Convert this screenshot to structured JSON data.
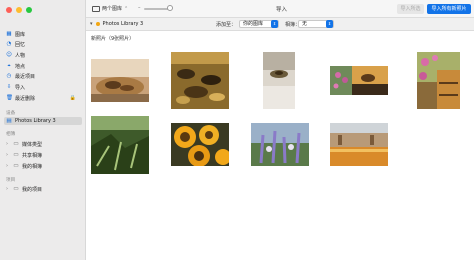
{
  "sidebar": {
    "sections": [
      {
        "title": ""
      },
      {
        "title": "设备"
      },
      {
        "title": "相簿"
      },
      {
        "title": "项目"
      }
    ],
    "library_items": [
      {
        "label": "图库",
        "icon": "photos-icon"
      },
      {
        "label": "回忆",
        "icon": "memories-icon"
      },
      {
        "label": "人物",
        "icon": "people-icon"
      },
      {
        "label": "地点",
        "icon": "places-icon"
      },
      {
        "label": "最近项目",
        "icon": "recents-icon"
      },
      {
        "label": "导入",
        "icon": "import-icon"
      },
      {
        "label": "最近删除",
        "icon": "trash-icon",
        "locked": true
      }
    ],
    "device_items": [
      {
        "label": "Photos Library 3",
        "icon": "library-icon",
        "selected": true
      }
    ],
    "album_items": [
      {
        "label": "媒体类型"
      },
      {
        "label": "共享相簿"
      },
      {
        "label": "我的相簿"
      }
    ],
    "project_items": [
      {
        "label": "我的项目"
      }
    ]
  },
  "toolbar": {
    "view_label": "两个图库",
    "title": "导入",
    "import_selected_label": "导入所选",
    "import_all_label": "导入所有新照片"
  },
  "subbar": {
    "source_label": "Photos Library 3",
    "add_to_label": "添加至：",
    "add_to_value": "你的图库",
    "album_label": "相簿：",
    "album_value": "无"
  },
  "content": {
    "heading": "新照片（9张照片）"
  },
  "colors": {
    "accent": "#1273e8",
    "sidebar_bg": "#ecebeb",
    "selected_row": "#d6d6d6"
  }
}
